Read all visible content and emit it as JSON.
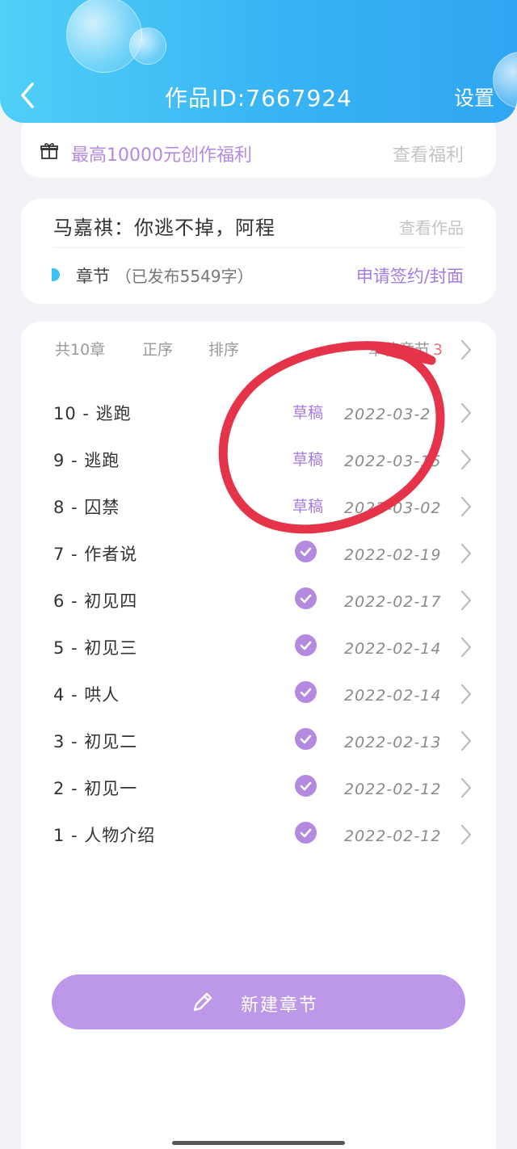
{
  "header": {
    "title": "作品ID:7667924",
    "settings_label": "设置",
    "back_icon": "chevron-left-icon",
    "gradient_colors": [
      "#4fd0f7",
      "#2fa6f2"
    ]
  },
  "welfare": {
    "icon": "gift-icon",
    "text": "最高10000元创作福利",
    "link_label": "查看福利"
  },
  "work": {
    "title": "马嘉祺：你逃不掉，阿程",
    "view_label": "查看作品",
    "chapter_label": "章节",
    "chapter_sub": "（已发布5549字）",
    "sign_label": "申请签约/封面"
  },
  "list": {
    "count_label": "共10章",
    "order_label": "正序",
    "sort_label": "排序",
    "drafts_label": "草稿章节",
    "drafts_count": "3",
    "rows": [
      {
        "title": "10 - 逃跑",
        "status": "草稿",
        "published": false,
        "date": "2022-03-2"
      },
      {
        "title": "9 - 逃跑",
        "status": "草稿",
        "published": false,
        "date": "2022-03-15"
      },
      {
        "title": "8 - 囚禁",
        "status": "草稿",
        "published": false,
        "date": "2022-03-02"
      },
      {
        "title": "7 - 作者说",
        "status": "",
        "published": true,
        "date": "2022-02-19"
      },
      {
        "title": "6 - 初见四",
        "status": "",
        "published": true,
        "date": "2022-02-17"
      },
      {
        "title": "5 - 初见三",
        "status": "",
        "published": true,
        "date": "2022-02-14"
      },
      {
        "title": "4 - 哄人",
        "status": "",
        "published": true,
        "date": "2022-02-14"
      },
      {
        "title": "3 - 初见二",
        "status": "",
        "published": true,
        "date": "2022-02-13"
      },
      {
        "title": "2 - 初见一",
        "status": "",
        "published": true,
        "date": "2022-02-12"
      },
      {
        "title": "1 - 人物介绍",
        "status": "",
        "published": true,
        "date": "2022-02-12"
      }
    ]
  },
  "new_chapter_label": "新建章节",
  "colors": {
    "accent_purple": "#b48ae0",
    "button_purple": "#be98e8",
    "annotation_red": "#e5344a"
  }
}
